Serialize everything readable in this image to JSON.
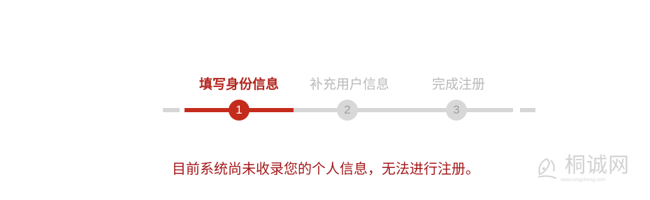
{
  "stepper": {
    "steps": [
      {
        "label": "填写身份信息",
        "number": "1",
        "state": "active"
      },
      {
        "label": "补充用户信息",
        "number": "2",
        "state": "pending"
      },
      {
        "label": "完成注册",
        "number": "3",
        "state": "pending"
      }
    ],
    "current_step": 1,
    "colors": {
      "active": "#c42b1c",
      "inactive": "#d6d6d6",
      "active_label": "#b3231c",
      "inactive_label": "#b9b9b9"
    }
  },
  "message": {
    "text": "目前系统尚未收录您的个人信息，无法进行注册。",
    "color": "#a4181a"
  },
  "watermark": {
    "brand": "桐诚网",
    "url": "www.tongcheng.com",
    "icon": "leaf-logo-icon"
  }
}
